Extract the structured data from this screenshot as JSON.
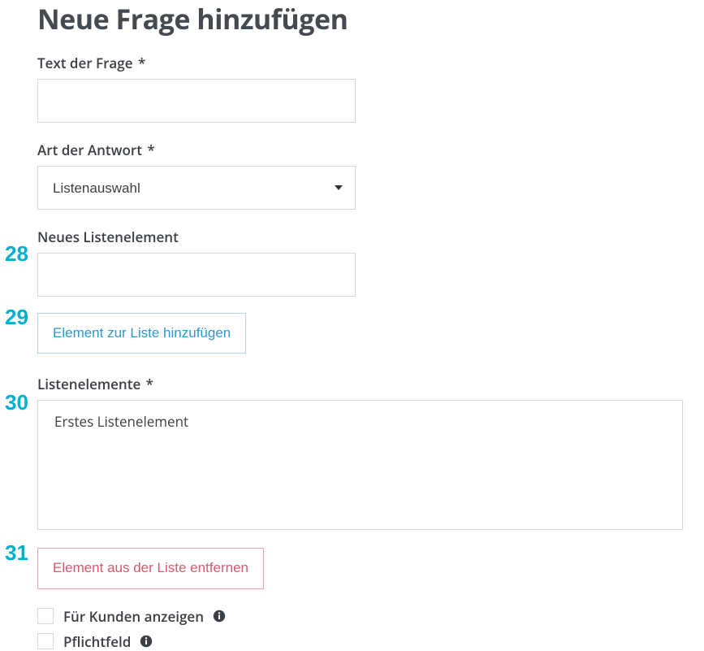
{
  "page_title": "Neue Frage hinzufügen",
  "fields": {
    "question_text": {
      "label": "Text der Frage",
      "required_mark": "*",
      "value": ""
    },
    "answer_type": {
      "label": "Art der Antwort",
      "required_mark": "*",
      "selected": "Listenauswahl"
    },
    "new_list_element": {
      "label": "Neues Listenelement",
      "value": ""
    },
    "list_elements": {
      "label": "Listenelemente",
      "required_mark": "*",
      "items": [
        "Erstes Listenelement"
      ]
    }
  },
  "buttons": {
    "add_element": "Element zur Liste hinzufügen",
    "remove_element": "Element aus der Liste entfernen"
  },
  "checkboxes": {
    "show_customers": {
      "label": "Für Kunden anzeigen",
      "checked": false
    },
    "mandatory": {
      "label": "Pflichtfeld",
      "checked": false
    }
  },
  "markers": {
    "m28": "28",
    "m29": "29",
    "m30": "30",
    "m31": "31"
  }
}
